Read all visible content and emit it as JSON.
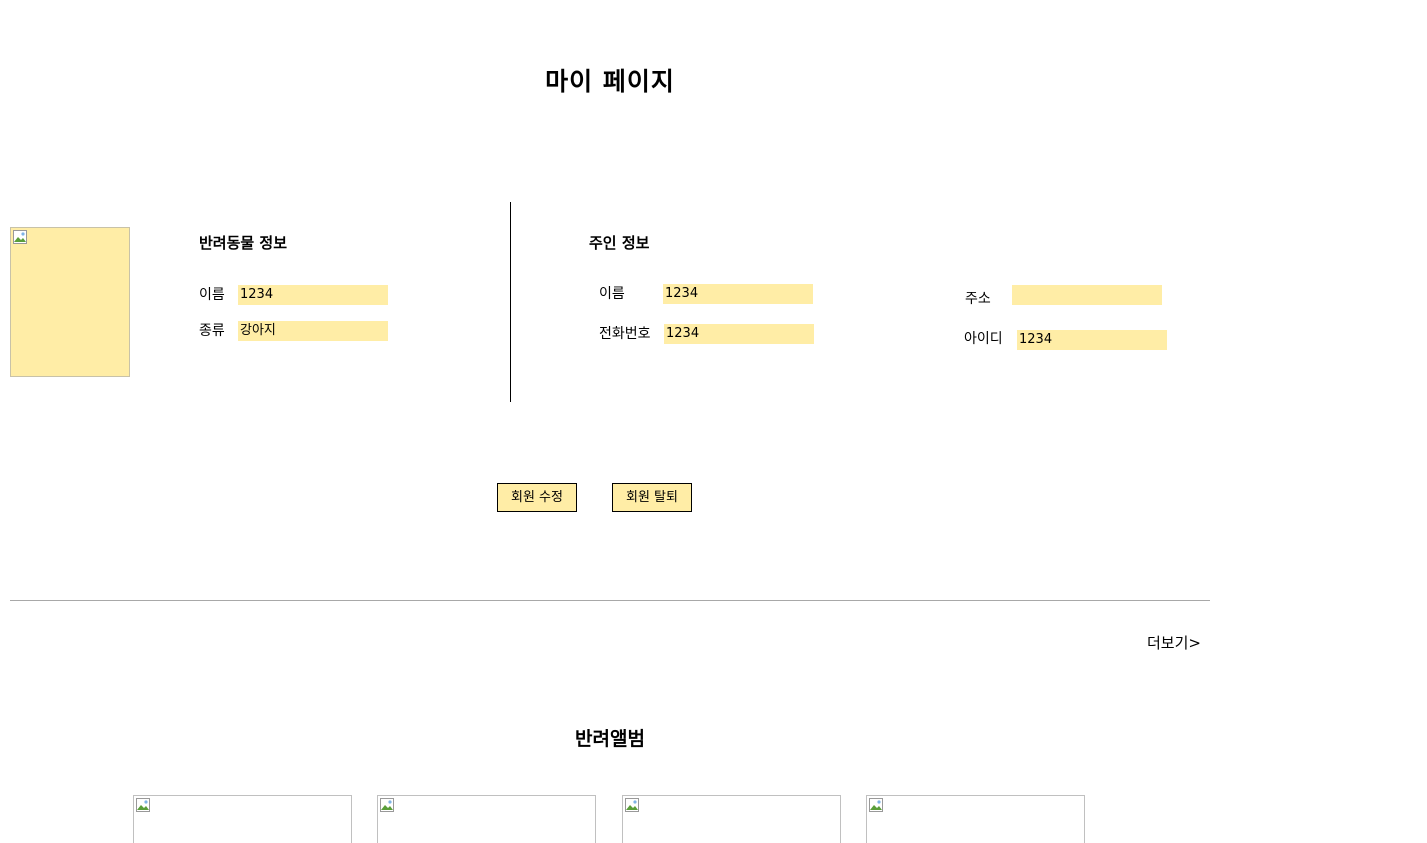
{
  "page_title": "마이 페이지",
  "pet_info": {
    "heading": "반려동물 정보",
    "fields": [
      {
        "label": "이름",
        "value": "1234"
      },
      {
        "label": "종류",
        "value": "강아지"
      }
    ]
  },
  "owner_info": {
    "heading": "주인 정보",
    "fields": [
      {
        "label": "이름",
        "value": "1234"
      },
      {
        "label": "전화번호",
        "value": "1234"
      },
      {
        "label": "주소",
        "value": ""
      },
      {
        "label": "아이디",
        "value": "1234"
      }
    ]
  },
  "buttons": {
    "edit": "회원 수정",
    "withdraw": "회원 탈퇴"
  },
  "more_link": "더보기>",
  "album": {
    "title": "반려앨범",
    "thumbnail_count": 4
  },
  "colors": {
    "field_bg": "#ffeda6",
    "divider": "#a8a8a8"
  },
  "icons": {
    "broken_image": "broken-image-icon"
  }
}
